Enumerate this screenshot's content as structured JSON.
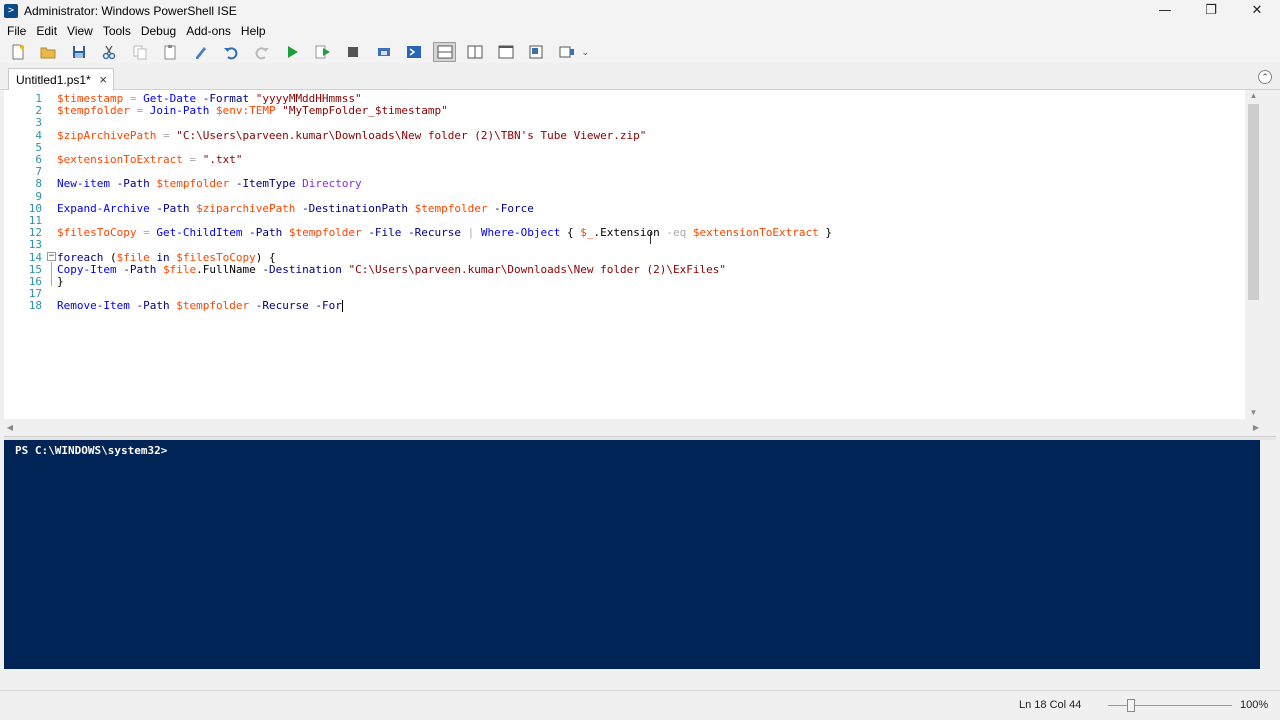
{
  "window": {
    "title": "Administrator: Windows PowerShell ISE",
    "icon": "powershell-icon",
    "controls": [
      "minimize-icon",
      "restore-icon",
      "close-icon"
    ]
  },
  "menu": {
    "items": [
      "File",
      "Edit",
      "View",
      "Tools",
      "Debug",
      "Add-ons",
      "Help"
    ]
  },
  "toolbar": {
    "buttons": [
      "new-icon",
      "open-icon",
      "save-icon",
      "cut-icon",
      "copy-icon",
      "paste-icon",
      "clear-icon",
      "undo-icon",
      "redo-icon",
      "run-icon",
      "run-selection-icon",
      "stop-icon",
      "remote-icon",
      "console-icon",
      "layout-top-icon",
      "layout-right-icon",
      "layout-max-icon",
      "command-addon-icon",
      "snippet-icon"
    ]
  },
  "tabs": [
    {
      "label": "Untitled1.ps1*",
      "close": "×"
    }
  ],
  "script": {
    "line_numbers": [
      "1",
      "2",
      "3",
      "4",
      "5",
      "6",
      "7",
      "8",
      "9",
      "10",
      "11",
      "12",
      "13",
      "14",
      "15",
      "16",
      "17",
      "18"
    ],
    "lines": [
      [
        [
          "t-var",
          "$timestamp"
        ],
        [
          "t-plain",
          " "
        ],
        [
          "t-op",
          "="
        ],
        [
          "t-plain",
          " "
        ],
        [
          "t-cmd",
          "Get-Date"
        ],
        [
          "t-plain",
          " "
        ],
        [
          "t-param",
          "-Format"
        ],
        [
          "t-plain",
          " "
        ],
        [
          "t-str",
          "\"yyyyMMddHHmmss\""
        ]
      ],
      [
        [
          "t-var",
          "$tempfolder"
        ],
        [
          "t-plain",
          " "
        ],
        [
          "t-op",
          "="
        ],
        [
          "t-plain",
          " "
        ],
        [
          "t-cmd",
          "Join-Path"
        ],
        [
          "t-plain",
          " "
        ],
        [
          "t-var",
          "$env:TEMP"
        ],
        [
          "t-plain",
          " "
        ],
        [
          "t-str",
          "\"MyTempFolder_$timestamp\""
        ]
      ],
      [],
      [
        [
          "t-var",
          "$zipArchivePath"
        ],
        [
          "t-plain",
          " "
        ],
        [
          "t-op",
          "="
        ],
        [
          "t-plain",
          " "
        ],
        [
          "t-str",
          "\"C:\\Users\\parveen.kumar\\Downloads\\New folder (2)\\TBN's Tube Viewer.zip\""
        ]
      ],
      [],
      [
        [
          "t-var",
          "$extensionToExtract"
        ],
        [
          "t-plain",
          " "
        ],
        [
          "t-op",
          "="
        ],
        [
          "t-plain",
          " "
        ],
        [
          "t-str",
          "\".txt\""
        ]
      ],
      [],
      [
        [
          "t-cmd",
          "New-item"
        ],
        [
          "t-plain",
          " "
        ],
        [
          "t-param",
          "-Path"
        ],
        [
          "t-plain",
          " "
        ],
        [
          "t-var",
          "$tempfolder"
        ],
        [
          "t-plain",
          " "
        ],
        [
          "t-param",
          "-ItemType"
        ],
        [
          "t-plain",
          " "
        ],
        [
          "t-arg",
          "Directory"
        ]
      ],
      [],
      [
        [
          "t-cmd",
          "Expand-Archive"
        ],
        [
          "t-plain",
          " "
        ],
        [
          "t-param",
          "-Path"
        ],
        [
          "t-plain",
          " "
        ],
        [
          "t-var",
          "$ziparchivePath"
        ],
        [
          "t-plain",
          " "
        ],
        [
          "t-param",
          "-DestinationPath"
        ],
        [
          "t-plain",
          " "
        ],
        [
          "t-var",
          "$tempfolder"
        ],
        [
          "t-plain",
          " "
        ],
        [
          "t-param",
          "-Force"
        ]
      ],
      [],
      [
        [
          "t-var",
          "$filesToCopy"
        ],
        [
          "t-plain",
          " "
        ],
        [
          "t-op",
          "="
        ],
        [
          "t-plain",
          " "
        ],
        [
          "t-cmd",
          "Get-ChildItem"
        ],
        [
          "t-plain",
          " "
        ],
        [
          "t-param",
          "-Path"
        ],
        [
          "t-plain",
          " "
        ],
        [
          "t-var",
          "$tempfolder"
        ],
        [
          "t-plain",
          " "
        ],
        [
          "t-param",
          "-File"
        ],
        [
          "t-plain",
          " "
        ],
        [
          "t-param",
          "-Recurse"
        ],
        [
          "t-plain",
          " "
        ],
        [
          "t-op",
          "|"
        ],
        [
          "t-plain",
          " "
        ],
        [
          "t-cmd",
          "Where-Object"
        ],
        [
          "t-plain",
          " { "
        ],
        [
          "t-var",
          "$_"
        ],
        [
          "t-plain",
          ".Extension "
        ],
        [
          "t-op",
          "-eq"
        ],
        [
          "t-plain",
          " "
        ],
        [
          "t-var",
          "$extensionToExtract"
        ],
        [
          "t-plain",
          " }"
        ]
      ],
      [],
      [
        [
          "t-kw",
          "foreach"
        ],
        [
          "t-plain",
          " ("
        ],
        [
          "t-var",
          "$file"
        ],
        [
          "t-plain",
          " "
        ],
        [
          "t-kw",
          "in"
        ],
        [
          "t-plain",
          " "
        ],
        [
          "t-var",
          "$filesToCopy"
        ],
        [
          "t-plain",
          ") {"
        ]
      ],
      [
        [
          "t-cmd",
          "Copy-Item"
        ],
        [
          "t-plain",
          " "
        ],
        [
          "t-param",
          "-Path"
        ],
        [
          "t-plain",
          " "
        ],
        [
          "t-var",
          "$file"
        ],
        [
          "t-plain",
          ".FullName "
        ],
        [
          "t-param",
          "-Destination"
        ],
        [
          "t-plain",
          " "
        ],
        [
          "t-str",
          "\"C:\\Users\\parveen.kumar\\Downloads\\New folder (2)\\ExFiles\""
        ]
      ],
      [
        [
          "t-plain",
          "}"
        ]
      ],
      [],
      [
        [
          "t-cmd",
          "Remove-Item"
        ],
        [
          "t-plain",
          " "
        ],
        [
          "t-param",
          "-Path"
        ],
        [
          "t-plain",
          " "
        ],
        [
          "t-var",
          "$tempfolder"
        ],
        [
          "t-plain",
          " "
        ],
        [
          "t-param",
          "-Recurse"
        ],
        [
          "t-plain",
          " "
        ],
        [
          "t-param",
          "-For"
        ]
      ]
    ],
    "fold_marker": "−"
  },
  "console": {
    "prompt": "PS C:\\WINDOWS\\system32>"
  },
  "status": {
    "position": "Ln 18  Col 44",
    "zoom": "100%"
  },
  "colors": {
    "console_background": "#012456",
    "variable": "#ff4500",
    "command": "#0000ff",
    "string": "#8b0000",
    "line_number": "#2b91af"
  }
}
